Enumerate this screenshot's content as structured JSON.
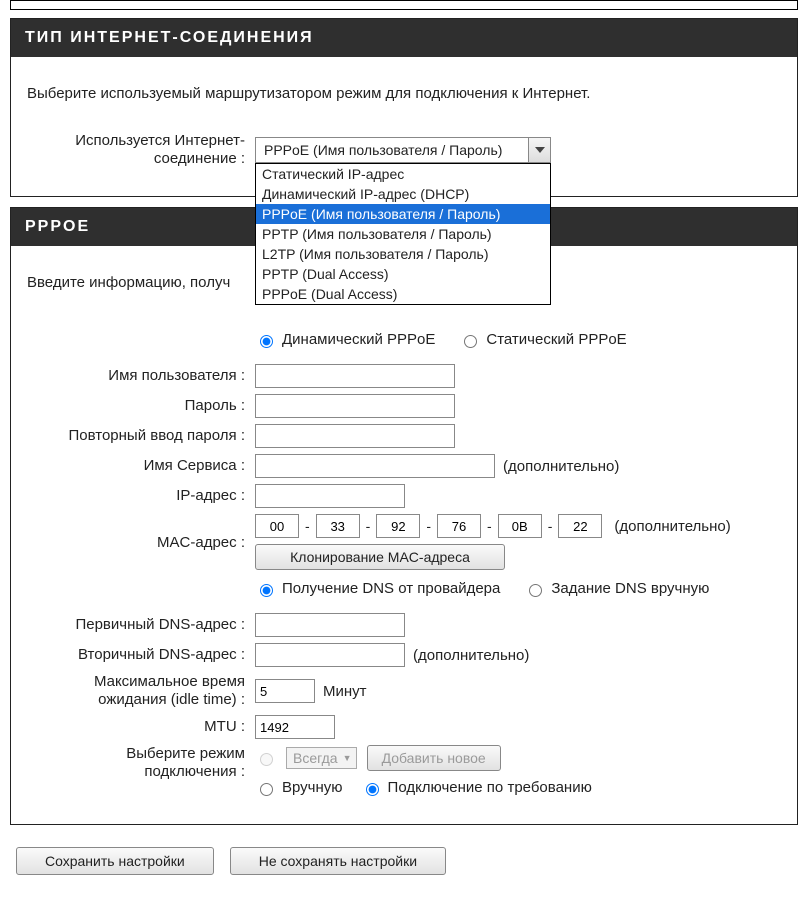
{
  "sections": {
    "connectionType": {
      "title": "ТИП ИНТЕРНЕТ-СОЕДИНЕНИЯ",
      "intro": "Выберите используемый маршрутизатором режим для подключения к Интернет.",
      "label": "Используется Интернет-соединение :",
      "selected": "PPPoE (Имя пользователя / Пароль)",
      "options": [
        "Статический IP-адрес",
        "Динамический IP-адрес (DHCP)",
        "PPPoE (Имя пользователя / Пароль)",
        "PPTP (Имя пользователя / Пароль)",
        "L2TP (Имя пользователя / Пароль)",
        "PPTP (Dual Access)",
        "PPPoE (Dual Access)"
      ]
    },
    "pppoe": {
      "title": "PPPOE",
      "intro": "Введите информацию, получ",
      "mode": {
        "dynamic": "Динамический PPPoE",
        "static": "Статический PPPoE"
      },
      "labels": {
        "username": "Имя пользователя :",
        "password": "Пароль :",
        "confirmPassword": "Повторный ввод пароля :",
        "service": "Имя Сервиса :",
        "ip": "IP-адрес :",
        "mac": "MAC-адрес :",
        "cloneMac": "Клонирование MAC-адреса",
        "dnsPrimary": "Первичный DNS-адрес :",
        "dnsSecondary": "Вторичный DNS-адрес :",
        "idle": "Максимальное время ожидания (idle time) :",
        "mtu": "MTU :",
        "connMode": "Выберите режим подключения :"
      },
      "optional": "(дополнительно)",
      "minutes": "Минут",
      "values": {
        "username": "",
        "password": "",
        "confirmPassword": "",
        "service": "",
        "ip": "",
        "mac": [
          "00",
          "33",
          "92",
          "76",
          "0B",
          "22"
        ],
        "dnsPrimary": "",
        "dnsSecondary": "",
        "idle": "5",
        "mtu": "1492"
      },
      "dnsMode": {
        "provider": "Получение DNS от провайдера",
        "manual": "Задание DNS вручную"
      },
      "connMode": {
        "always": "Всегда",
        "addNew": "Добавить новое",
        "manual": "Вручную",
        "onDemand": "Подключение по требованию"
      }
    }
  },
  "buttons": {
    "save": "Сохранить настройки",
    "cancel": "Не сохранять настройки"
  }
}
